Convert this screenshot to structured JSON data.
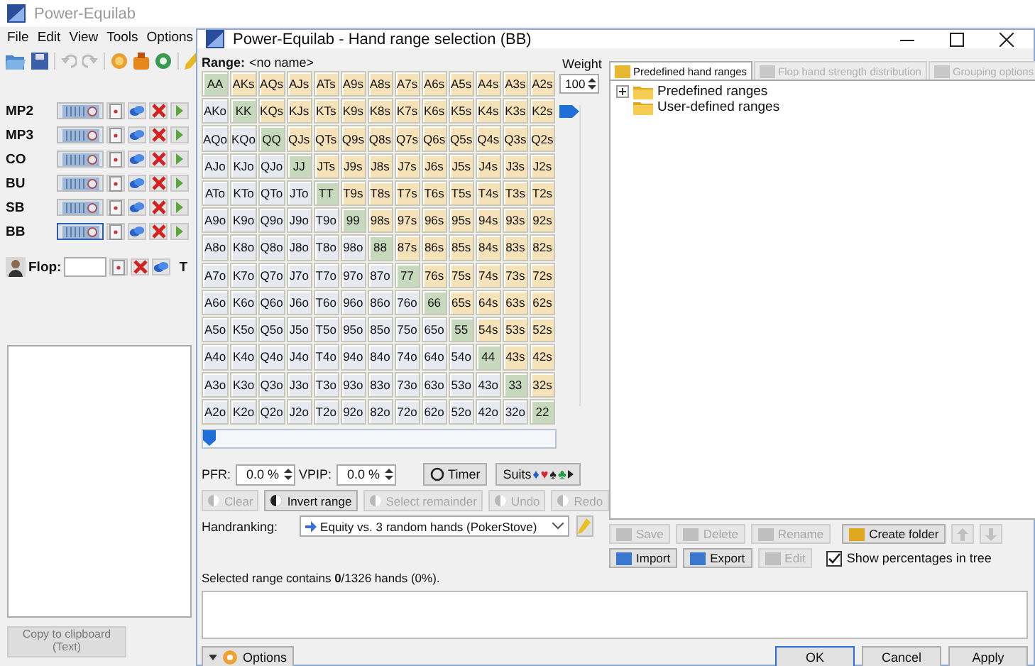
{
  "main_window": {
    "title": "Power-Equilab",
    "menu": [
      "File",
      "Edit",
      "View",
      "Tools",
      "Options"
    ],
    "players": [
      {
        "position": "MP2",
        "focused": false
      },
      {
        "position": "MP3",
        "focused": false
      },
      {
        "position": "CO",
        "focused": false
      },
      {
        "position": "BU",
        "focused": false
      },
      {
        "position": "SB",
        "focused": false
      },
      {
        "position": "BB",
        "focused": true
      }
    ],
    "flop_label": "Flop:",
    "turn_label": "T",
    "copy_button": {
      "label": "Copy to clipboard (Text)",
      "disabled": true
    }
  },
  "dialog": {
    "title": "Power-Equilab - Hand range selection (BB)",
    "range_label": "Range:",
    "range_name": "<no name>",
    "grid": [
      [
        {
          "hand": "AA",
          "selected": false
        },
        {
          "hand": "AKs",
          "selected": false
        },
        {
          "hand": "AQs",
          "selected": false
        },
        {
          "hand": "AJs",
          "selected": false
        },
        {
          "hand": "ATs",
          "selected": false
        },
        {
          "hand": "A9s",
          "selected": false
        },
        {
          "hand": "A8s",
          "selected": false
        },
        {
          "hand": "A7s",
          "selected": false
        },
        {
          "hand": "A6s",
          "selected": false
        },
        {
          "hand": "A5s",
          "selected": false
        },
        {
          "hand": "A4s",
          "selected": false
        },
        {
          "hand": "A3s",
          "selected": false
        },
        {
          "hand": "A2s",
          "selected": false
        }
      ],
      [
        {
          "hand": "AKo",
          "selected": false
        },
        {
          "hand": "KK",
          "selected": false
        },
        {
          "hand": "KQs",
          "selected": false
        },
        {
          "hand": "KJs",
          "selected": false
        },
        {
          "hand": "KTs",
          "selected": false
        },
        {
          "hand": "K9s",
          "selected": false
        },
        {
          "hand": "K8s",
          "selected": false
        },
        {
          "hand": "K7s",
          "selected": false
        },
        {
          "hand": "K6s",
          "selected": false
        },
        {
          "hand": "K5s",
          "selected": false
        },
        {
          "hand": "K4s",
          "selected": false
        },
        {
          "hand": "K3s",
          "selected": false
        },
        {
          "hand": "K2s",
          "selected": false
        }
      ],
      [
        {
          "hand": "AQo",
          "selected": false
        },
        {
          "hand": "KQo",
          "selected": false
        },
        {
          "hand": "QQ",
          "selected": false
        },
        {
          "hand": "QJs",
          "selected": false
        },
        {
          "hand": "QTs",
          "selected": false
        },
        {
          "hand": "Q9s",
          "selected": false
        },
        {
          "hand": "Q8s",
          "selected": false
        },
        {
          "hand": "Q7s",
          "selected": false
        },
        {
          "hand": "Q6s",
          "selected": false
        },
        {
          "hand": "Q5s",
          "selected": false
        },
        {
          "hand": "Q4s",
          "selected": false
        },
        {
          "hand": "Q3s",
          "selected": false
        },
        {
          "hand": "Q2s",
          "selected": false
        }
      ],
      [
        {
          "hand": "AJo",
          "selected": false
        },
        {
          "hand": "KJo",
          "selected": false
        },
        {
          "hand": "QJo",
          "selected": false
        },
        {
          "hand": "JJ",
          "selected": false
        },
        {
          "hand": "JTs",
          "selected": false
        },
        {
          "hand": "J9s",
          "selected": false
        },
        {
          "hand": "J8s",
          "selected": false
        },
        {
          "hand": "J7s",
          "selected": false
        },
        {
          "hand": "J6s",
          "selected": false
        },
        {
          "hand": "J5s",
          "selected": false
        },
        {
          "hand": "J4s",
          "selected": false
        },
        {
          "hand": "J3s",
          "selected": false
        },
        {
          "hand": "J2s",
          "selected": false
        }
      ],
      [
        {
          "hand": "ATo",
          "selected": false
        },
        {
          "hand": "KTo",
          "selected": false
        },
        {
          "hand": "QTo",
          "selected": false
        },
        {
          "hand": "JTo",
          "selected": false
        },
        {
          "hand": "TT",
          "selected": false
        },
        {
          "hand": "T9s",
          "selected": false
        },
        {
          "hand": "T8s",
          "selected": false
        },
        {
          "hand": "T7s",
          "selected": false
        },
        {
          "hand": "T6s",
          "selected": false
        },
        {
          "hand": "T5s",
          "selected": false
        },
        {
          "hand": "T4s",
          "selected": false
        },
        {
          "hand": "T3s",
          "selected": false
        },
        {
          "hand": "T2s",
          "selected": false
        }
      ],
      [
        {
          "hand": "A9o",
          "selected": false
        },
        {
          "hand": "K9o",
          "selected": false
        },
        {
          "hand": "Q9o",
          "selected": false
        },
        {
          "hand": "J9o",
          "selected": false
        },
        {
          "hand": "T9o",
          "selected": false
        },
        {
          "hand": "99",
          "selected": false
        },
        {
          "hand": "98s",
          "selected": false
        },
        {
          "hand": "97s",
          "selected": false
        },
        {
          "hand": "96s",
          "selected": false
        },
        {
          "hand": "95s",
          "selected": false
        },
        {
          "hand": "94s",
          "selected": false
        },
        {
          "hand": "93s",
          "selected": false
        },
        {
          "hand": "92s",
          "selected": false
        }
      ],
      [
        {
          "hand": "A8o",
          "selected": false
        },
        {
          "hand": "K8o",
          "selected": false
        },
        {
          "hand": "Q8o",
          "selected": false
        },
        {
          "hand": "J8o",
          "selected": false
        },
        {
          "hand": "T8o",
          "selected": false
        },
        {
          "hand": "98o",
          "selected": false
        },
        {
          "hand": "88",
          "selected": false
        },
        {
          "hand": "87s",
          "selected": false
        },
        {
          "hand": "86s",
          "selected": false
        },
        {
          "hand": "85s",
          "selected": false
        },
        {
          "hand": "84s",
          "selected": false
        },
        {
          "hand": "83s",
          "selected": false
        },
        {
          "hand": "82s",
          "selected": false
        }
      ],
      [
        {
          "hand": "A7o",
          "selected": false
        },
        {
          "hand": "K7o",
          "selected": false
        },
        {
          "hand": "Q7o",
          "selected": false
        },
        {
          "hand": "J7o",
          "selected": false
        },
        {
          "hand": "T7o",
          "selected": false
        },
        {
          "hand": "97o",
          "selected": false
        },
        {
          "hand": "87o",
          "selected": false
        },
        {
          "hand": "77",
          "selected": false
        },
        {
          "hand": "76s",
          "selected": false
        },
        {
          "hand": "75s",
          "selected": false
        },
        {
          "hand": "74s",
          "selected": false
        },
        {
          "hand": "73s",
          "selected": false
        },
        {
          "hand": "72s",
          "selected": false
        }
      ],
      [
        {
          "hand": "A6o",
          "selected": false
        },
        {
          "hand": "K6o",
          "selected": false
        },
        {
          "hand": "Q6o",
          "selected": false
        },
        {
          "hand": "J6o",
          "selected": false
        },
        {
          "hand": "T6o",
          "selected": false
        },
        {
          "hand": "96o",
          "selected": false
        },
        {
          "hand": "86o",
          "selected": false
        },
        {
          "hand": "76o",
          "selected": false
        },
        {
          "hand": "66",
          "selected": false
        },
        {
          "hand": "65s",
          "selected": false
        },
        {
          "hand": "64s",
          "selected": false
        },
        {
          "hand": "63s",
          "selected": false
        },
        {
          "hand": "62s",
          "selected": false
        }
      ],
      [
        {
          "hand": "A5o",
          "selected": false
        },
        {
          "hand": "K5o",
          "selected": false
        },
        {
          "hand": "Q5o",
          "selected": false
        },
        {
          "hand": "J5o",
          "selected": false
        },
        {
          "hand": "T5o",
          "selected": false
        },
        {
          "hand": "95o",
          "selected": false
        },
        {
          "hand": "85o",
          "selected": false
        },
        {
          "hand": "75o",
          "selected": false
        },
        {
          "hand": "65o",
          "selected": false
        },
        {
          "hand": "55",
          "selected": false
        },
        {
          "hand": "54s",
          "selected": false
        },
        {
          "hand": "53s",
          "selected": false
        },
        {
          "hand": "52s",
          "selected": false
        }
      ],
      [
        {
          "hand": "A4o",
          "selected": false
        },
        {
          "hand": "K4o",
          "selected": false
        },
        {
          "hand": "Q4o",
          "selected": false
        },
        {
          "hand": "J4o",
          "selected": false
        },
        {
          "hand": "T4o",
          "selected": false
        },
        {
          "hand": "94o",
          "selected": false
        },
        {
          "hand": "84o",
          "selected": false
        },
        {
          "hand": "74o",
          "selected": false
        },
        {
          "hand": "64o",
          "selected": false
        },
        {
          "hand": "54o",
          "selected": false
        },
        {
          "hand": "44",
          "selected": false
        },
        {
          "hand": "43s",
          "selected": false
        },
        {
          "hand": "42s",
          "selected": false
        }
      ],
      [
        {
          "hand": "A3o",
          "selected": false
        },
        {
          "hand": "K3o",
          "selected": false
        },
        {
          "hand": "Q3o",
          "selected": false
        },
        {
          "hand": "J3o",
          "selected": false
        },
        {
          "hand": "T3o",
          "selected": false
        },
        {
          "hand": "93o",
          "selected": false
        },
        {
          "hand": "83o",
          "selected": false
        },
        {
          "hand": "73o",
          "selected": false
        },
        {
          "hand": "63o",
          "selected": false
        },
        {
          "hand": "53o",
          "selected": false
        },
        {
          "hand": "43o",
          "selected": false
        },
        {
          "hand": "33",
          "selected": false
        },
        {
          "hand": "32s",
          "selected": false
        }
      ],
      [
        {
          "hand": "A2o",
          "selected": false
        },
        {
          "hand": "K2o",
          "selected": false
        },
        {
          "hand": "Q2o",
          "selected": false
        },
        {
          "hand": "J2o",
          "selected": false
        },
        {
          "hand": "T2o",
          "selected": false
        },
        {
          "hand": "92o",
          "selected": false
        },
        {
          "hand": "82o",
          "selected": false
        },
        {
          "hand": "72o",
          "selected": false
        },
        {
          "hand": "62o",
          "selected": false
        },
        {
          "hand": "52o",
          "selected": false
        },
        {
          "hand": "42o",
          "selected": false
        },
        {
          "hand": "32o",
          "selected": false
        },
        {
          "hand": "22",
          "selected": false
        }
      ]
    ],
    "weight": {
      "label": "Weight",
      "value": "100",
      "level": 1
    },
    "range_slider": {
      "level": 0
    },
    "pfr": {
      "label": "PFR:",
      "value": "0.0 %"
    },
    "vpip": {
      "label": "VPIP:",
      "value": "0.0 %"
    },
    "timer_button": "Timer",
    "suits_button": {
      "label": "Suits",
      "symbols": [
        {
          "symbol": "♦",
          "color": "#1f5fd0"
        },
        {
          "symbol": "♥",
          "color": "#e0202a"
        },
        {
          "symbol": "♠",
          "color": "#202020"
        },
        {
          "symbol": "♣",
          "color": "#1a9a40"
        }
      ]
    },
    "action_buttons": [
      {
        "label": "Clear",
        "disabled": true
      },
      {
        "label": "Invert range",
        "disabled": false
      },
      {
        "label": "Select remainder",
        "disabled": true
      },
      {
        "label": "Undo",
        "disabled": true
      },
      {
        "label": "Redo",
        "disabled": true
      }
    ],
    "handranking": {
      "label": "Handranking:",
      "value": "Equity vs. 3 random hands (PokerStove)"
    },
    "summary": "Selected range contains **0**/1326 hands (0%).",
    "tabs": [
      {
        "label": "Predefined hand ranges",
        "selected": true,
        "disabled": false
      },
      {
        "label": "Flop hand strength distribution",
        "selected": false,
        "disabled": true
      },
      {
        "label": "Grouping options",
        "selected": false,
        "disabled": true
      }
    ],
    "tree": [
      {
        "label": "Predefined ranges",
        "expanded": false
      },
      {
        "label": "User-defined ranges"
      }
    ],
    "range_buttons": [
      {
        "label": "Save",
        "disabled": true
      },
      {
        "label": "Delete",
        "disabled": true
      },
      {
        "label": "Rename",
        "disabled": true
      },
      {
        "label": "Create folder",
        "disabled": false
      }
    ],
    "file_buttons": [
      {
        "label": "Import",
        "disabled": false
      },
      {
        "label": "Export",
        "disabled": false
      },
      {
        "label": "Edit",
        "disabled": true
      }
    ],
    "show_percentages": {
      "label": "Show percentages in tree",
      "checked": true
    },
    "options_button": "Options",
    "footer_buttons": [
      {
        "label": "OK",
        "default": true
      },
      {
        "label": "Cancel",
        "default": false
      },
      {
        "label": "Apply",
        "default": false
      }
    ]
  }
}
